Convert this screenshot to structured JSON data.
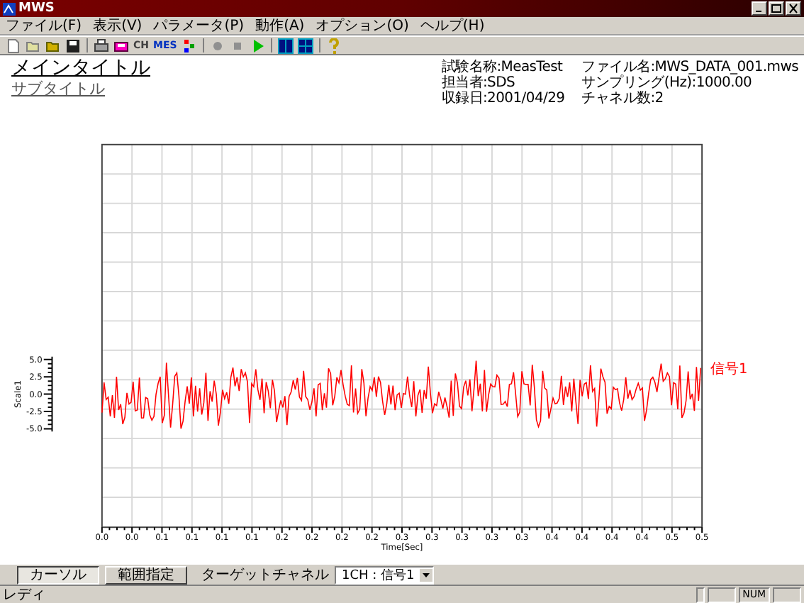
{
  "window": {
    "title": "MWS"
  },
  "menu": [
    "ファイル(F)",
    "表示(V)",
    "パラメータ(P)",
    "動作(A)",
    "オプション(O)",
    "ヘルプ(H)"
  ],
  "toolbar": {
    "ch_button": "CH",
    "mes_button": "MES"
  },
  "titles": {
    "main": "メインタイトル",
    "sub": "サブタイトル"
  },
  "info": {
    "left": [
      "試験名称:MeasTest",
      "担当者:SDS",
      "収録日:2001/04/29"
    ],
    "right": [
      "ファイル名:MWS_DATA_001.mws",
      "サンプリング(Hz):1000.00",
      "チャネル数:2"
    ]
  },
  "plot": {
    "ylabel": "Scale1",
    "yticks": [
      "5.0",
      "2.5",
      "0.0",
      "-2.5",
      "-5.0"
    ],
    "xlabel": "Time[Sec]",
    "xticks": [
      "0.0",
      "0.0",
      "0.1",
      "0.1",
      "0.1",
      "0.1",
      "0.2",
      "0.2",
      "0.2",
      "0.2",
      "0.3",
      "0.3",
      "0.3",
      "0.3",
      "0.3",
      "0.4",
      "0.4",
      "0.4",
      "0.4",
      "0.5",
      "0.5"
    ],
    "legend": [
      {
        "name": "信号1",
        "color": "#ff0000"
      }
    ]
  },
  "controls": {
    "modes": [
      {
        "label": "カーソル",
        "selected": true
      },
      {
        "label": "範囲指定",
        "selected": false
      }
    ],
    "target_label": "ターゲットチャネル",
    "target_value": "1CH : 信号1"
  },
  "status": {
    "text": "レディ",
    "num": "NUM"
  }
}
